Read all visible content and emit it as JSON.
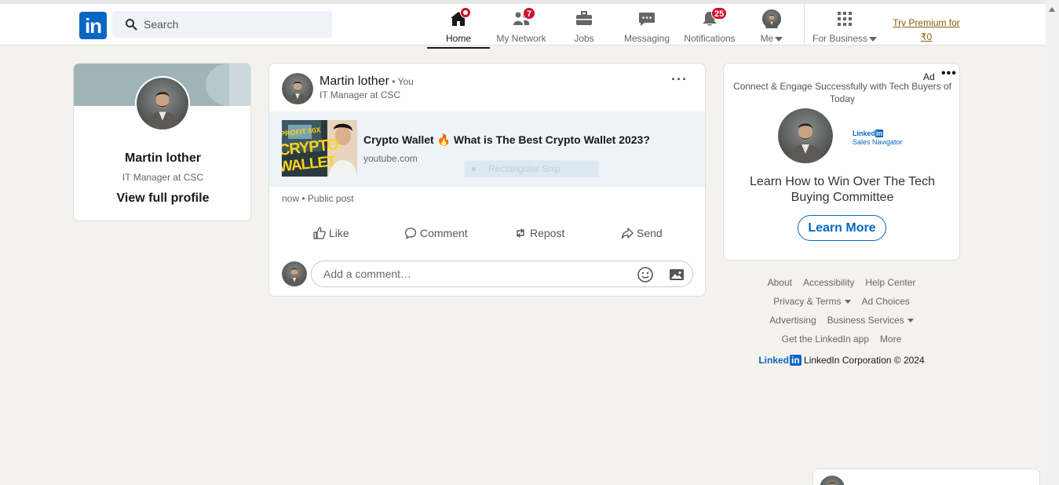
{
  "nav": {
    "logo_text": "in",
    "search_placeholder": "Search",
    "items": [
      {
        "label": "Home",
        "badge": ""
      },
      {
        "label": "My Network",
        "badge": "7"
      },
      {
        "label": "Jobs",
        "badge": ""
      },
      {
        "label": "Messaging",
        "badge": ""
      },
      {
        "label": "Notifications",
        "badge": "25"
      },
      {
        "label": "Me",
        "badge": ""
      },
      {
        "label": "For Business",
        "badge": ""
      }
    ],
    "premium_line1": "Try Premium for",
    "premium_line2": "₹0"
  },
  "profile": {
    "name": "Martin lother",
    "title": "IT Manager at CSC",
    "link": "View full profile"
  },
  "post": {
    "author": "Martin lother",
    "you": " • You",
    "author_title": "IT Manager at CSC",
    "more": "···",
    "link_title": "Crypto Wallet 🔥 What is The Best Crypto Wallet 2023?",
    "link_domain": "youtube.com",
    "thumb_line1": "PROFIT 50X",
    "thumb_line2": "CRYPTO",
    "thumb_line3": "WALLET",
    "snip_label": "Rectangular Snip",
    "meta": "now • Public post",
    "actions": {
      "like": "Like",
      "comment": "Comment",
      "repost": "Repost",
      "send": "Send"
    },
    "comment_placeholder": "Add a comment…"
  },
  "ad": {
    "label": "Ad",
    "more": "•••",
    "headline": "Connect & Engage Successfully with Tech Buyers of Today",
    "logo_line1": "Linked",
    "logo_in": "in",
    "logo_line2": "Sales Navigator",
    "text": "Learn How to Win Over The Tech Buying Committee",
    "button": "Learn More"
  },
  "footer": {
    "links_row1": [
      "About",
      "Accessibility",
      "Help Center"
    ],
    "links_row2": [
      "Privacy & Terms",
      "Ad Choices"
    ],
    "links_row3": [
      "Advertising",
      "Business Services"
    ],
    "links_row4": [
      "Get the LinkedIn app",
      "More"
    ],
    "logo_text": "Linked",
    "logo_in": "in",
    "copyright": "LinkedIn Corporation © 2024"
  },
  "colors": {
    "brand": "#0a66c2",
    "badge": "#cb112d",
    "background": "#f4f2ee",
    "premium": "#915907"
  }
}
